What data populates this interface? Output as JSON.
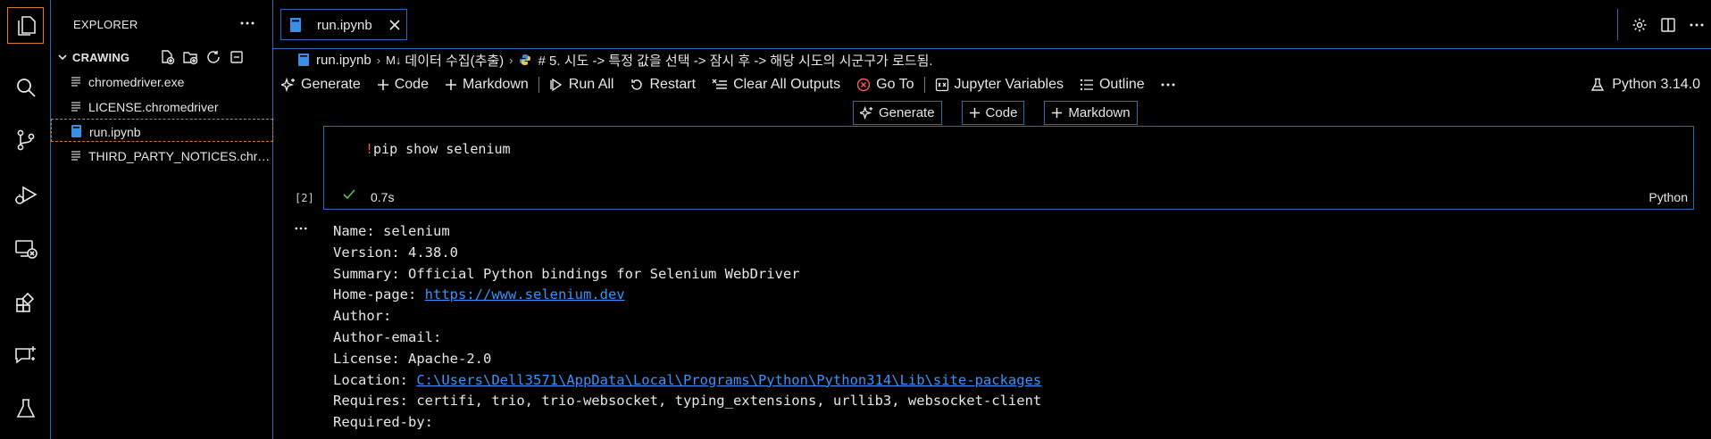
{
  "sidebar": {
    "title": "EXPLORER",
    "section": "CRAWING",
    "files": [
      {
        "name": "chromedriver.exe",
        "icon": "lines-file-icon"
      },
      {
        "name": "LICENSE.chromedriver",
        "icon": "lines-file-icon"
      },
      {
        "name": "run.ipynb",
        "icon": "notebook-file-icon"
      },
      {
        "name": "THIRD_PARTY_NOTICES.chromedriver",
        "icon": "lines-file-icon"
      }
    ]
  },
  "tabs": [
    {
      "label": "run.ipynb"
    }
  ],
  "breadcrumb": {
    "file": "run.ipynb",
    "section_prefix": "M↓",
    "section": "데이터 수집(추출)",
    "cell": "# 5. 시도 -> 특정 값을 선택 -> 잠시 후 -> 해당 시도의 시군구가 로드됨."
  },
  "toolbar": {
    "generate": "Generate",
    "code": "Code",
    "markdown": "Markdown",
    "run_all": "Run All",
    "restart": "Restart",
    "clear_all": "Clear All Outputs",
    "go_to": "Go To",
    "jupyter_variables": "Jupyter Variables",
    "outline": "Outline",
    "kernel": "Python 3.14.0"
  },
  "insert": {
    "generate": "Generate",
    "code": "Code",
    "markdown": "Markdown"
  },
  "cell": {
    "bang": "!",
    "command": "pip show selenium",
    "exec_count": "[2]",
    "time": "0.7s",
    "language": "Python"
  },
  "output": {
    "name_label": "Name:",
    "name": "selenium",
    "version_label": "Version:",
    "version": "4.38.0",
    "summary_label": "Summary:",
    "summary": "Official Python bindings for Selenium WebDriver",
    "homepage_label": "Home-page:",
    "homepage": "https://www.selenium.dev",
    "author_label": "Author:",
    "author_email_label": "Author-email:",
    "license_label": "License:",
    "license": "Apache-2.0",
    "location_label": "Location:",
    "location": "C:\\Users\\Dell3571\\AppData\\Local\\Programs\\Python\\Python314\\Lib\\site-packages",
    "requires_label": "Requires:",
    "requires": "certifi, trio, trio-websocket, typing_extensions, urllib3, websocket-client",
    "required_by_label": "Required-by:"
  },
  "colors": {
    "accent": "#2b6cb0",
    "focus": "#d97a2b",
    "link": "#3794ff",
    "error": "#ff5a5a",
    "success": "#4ec94e"
  }
}
